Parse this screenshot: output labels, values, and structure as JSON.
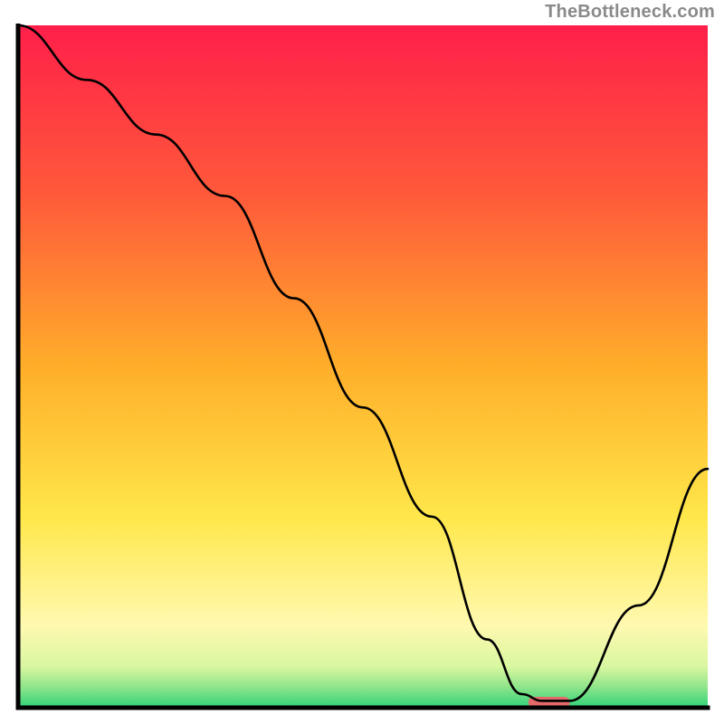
{
  "watermark": "TheBottleneck.com",
  "chart_data": {
    "type": "line",
    "title": "",
    "xlabel": "",
    "ylabel": "",
    "xlim": [
      0,
      100
    ],
    "ylim": [
      0,
      100
    ],
    "grid": false,
    "legend": false,
    "series": [
      {
        "name": "curve",
        "x": [
          0,
          10,
          20,
          30,
          40,
          50,
          60,
          68,
          73,
          76,
          80,
          90,
          100
        ],
        "y": [
          100,
          92,
          84,
          75,
          60,
          44,
          28,
          10,
          2,
          1,
          1,
          15,
          35
        ]
      }
    ],
    "marker": {
      "x_start": 74,
      "x_end": 80,
      "y": 0.8,
      "color": "#e46a6a"
    },
    "background_gradient": {
      "stops": [
        {
          "offset": 0,
          "color": "#ff1f4a"
        },
        {
          "offset": 25,
          "color": "#ff5a3a"
        },
        {
          "offset": 50,
          "color": "#ffae2a"
        },
        {
          "offset": 72,
          "color": "#ffe74a"
        },
        {
          "offset": 88,
          "color": "#fff9b0"
        },
        {
          "offset": 94,
          "color": "#d8f7a0"
        },
        {
          "offset": 97,
          "color": "#8ee48a"
        },
        {
          "offset": 100,
          "color": "#2fd37a"
        }
      ]
    },
    "axis_color": "#000000",
    "line_color": "#000000"
  }
}
